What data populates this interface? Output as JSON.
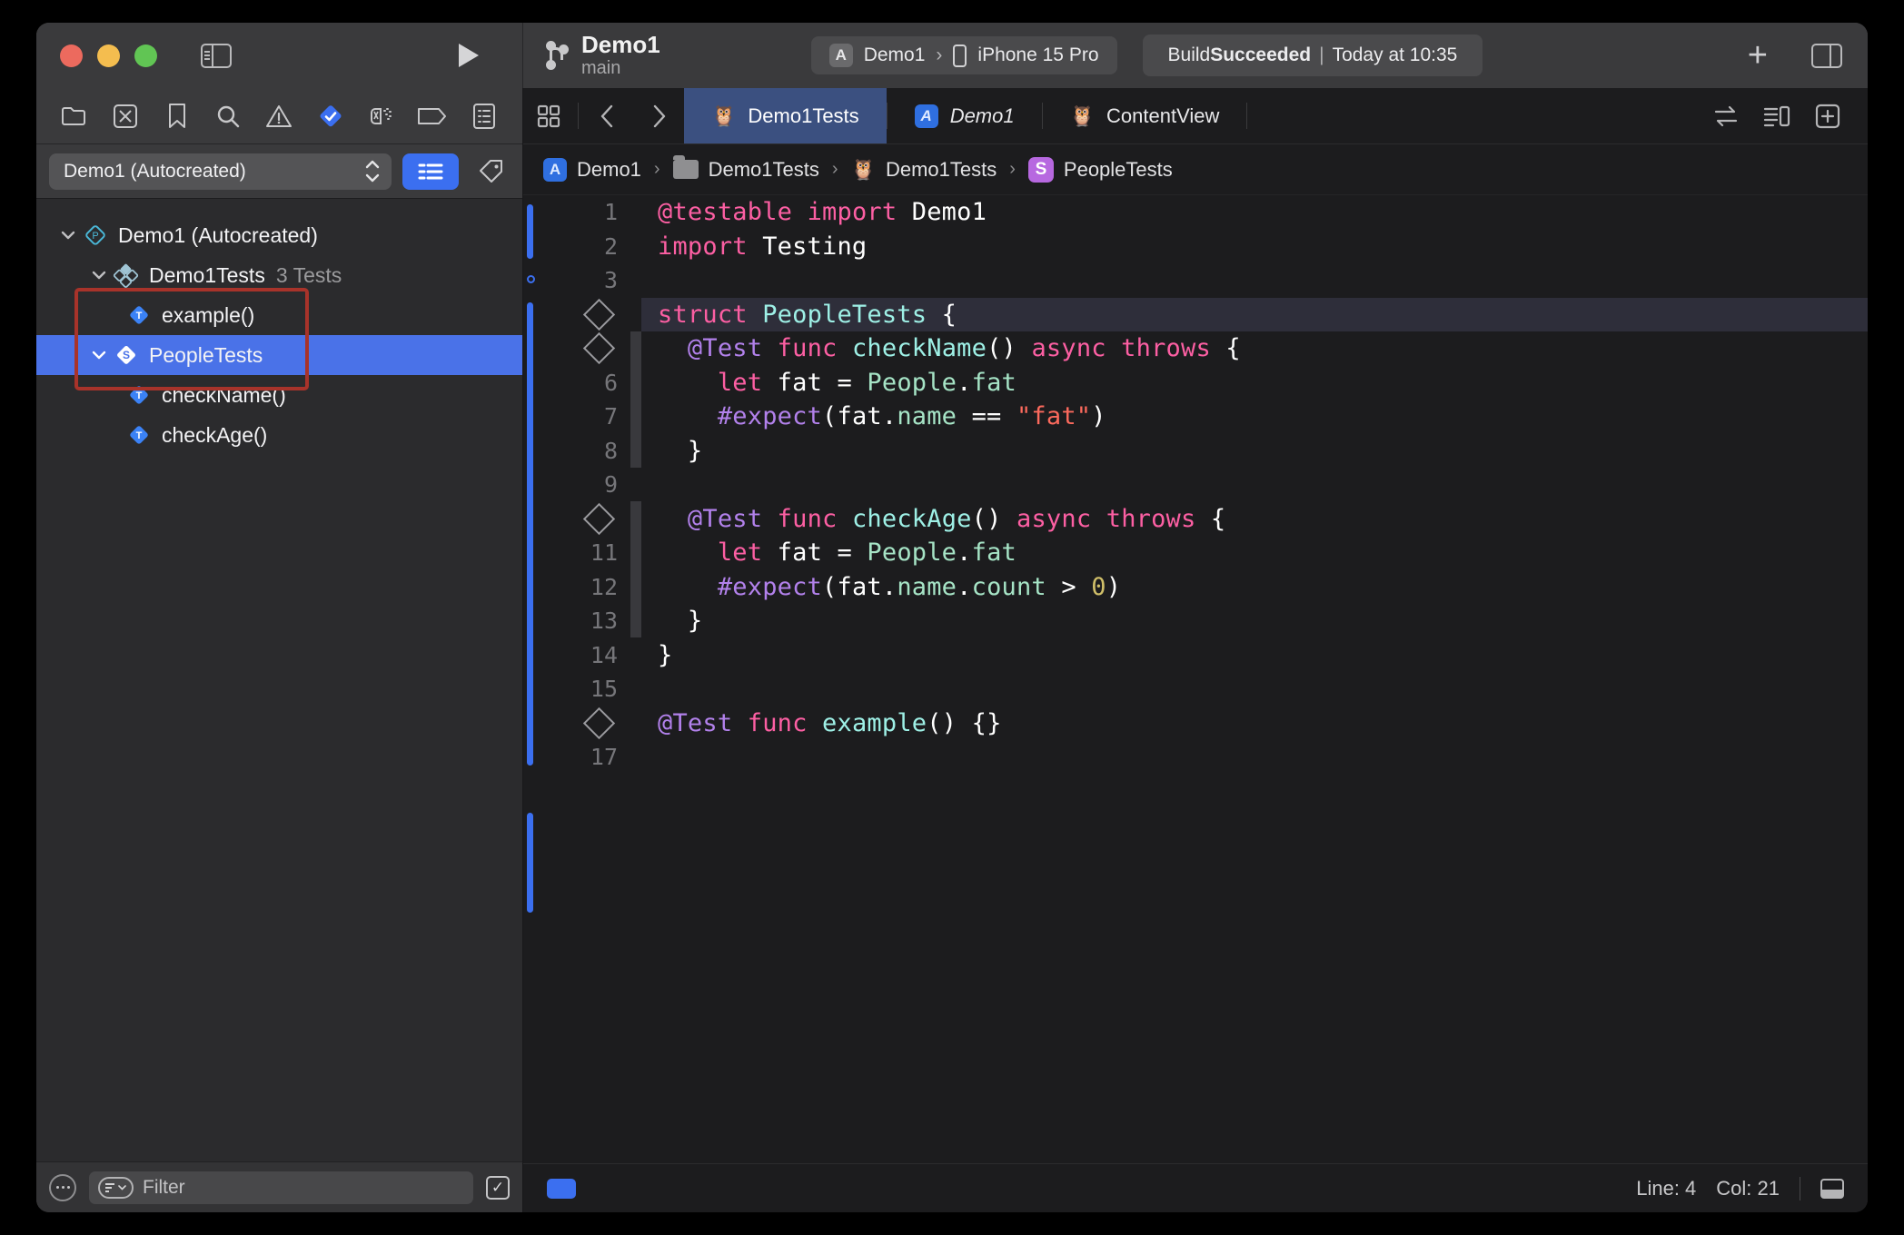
{
  "window": {
    "traffic_lights": [
      "close",
      "minimize",
      "zoom"
    ]
  },
  "titlebar": {
    "project_name": "Demo1",
    "branch": "main",
    "scheme": "Demo1",
    "scheme_separator": "›",
    "destination": "iPhone 15 Pro",
    "status_prefix": "Build ",
    "status_result": "Succeeded",
    "status_separator": "|",
    "status_time": "Today at 10:35",
    "add_label": "+"
  },
  "navigator": {
    "toolbar_icons": [
      "folder-icon",
      "source-control-icon",
      "bookmark-icon",
      "search-icon",
      "issue-warning-icon",
      "test-navigator-icon",
      "debug-navigator-icon",
      "breakpoint-navigator-icon",
      "report-navigator-icon"
    ],
    "scheme_selector": "Demo1 (Autocreated)",
    "list_button": "list-view-icon",
    "tag_button": "tag-icon",
    "tree": [
      {
        "label": "Demo1 (Autocreated)",
        "count": "",
        "icon": "plan-icon",
        "indent": 0,
        "disclosure": "open",
        "selected": false
      },
      {
        "label": "Demo1Tests",
        "count": "3 Tests",
        "icon": "test-bundle-icon",
        "indent": 1,
        "disclosure": "open",
        "selected": false
      },
      {
        "label": "example()",
        "count": "",
        "icon": "test-method-icon",
        "indent": 2,
        "disclosure": "none",
        "selected": false
      },
      {
        "label": "PeopleTests",
        "count": "",
        "icon": "struct-icon",
        "indent": 2,
        "disclosure": "open",
        "selected": true
      },
      {
        "label": "checkName()",
        "count": "",
        "icon": "test-method-icon",
        "indent": 3,
        "disclosure": "none",
        "selected": false
      },
      {
        "label": "checkAge()",
        "count": "",
        "icon": "test-method-icon",
        "indent": 3,
        "disclosure": "none",
        "selected": false
      }
    ],
    "filter_placeholder": "Filter",
    "highlight_color": "#a8332a",
    "selection_color": "#4a72e8"
  },
  "tabbar": {
    "left_icons": [
      "grid-layout-icon",
      "back-chevron-icon",
      "forward-chevron-icon"
    ],
    "tabs": [
      {
        "label": "Demo1Tests",
        "icon": "swift-file-icon",
        "active": true,
        "italic": false
      },
      {
        "label": "Demo1",
        "icon": "xcode-project-icon",
        "active": false,
        "italic": true
      },
      {
        "label": "ContentView",
        "icon": "swift-file-icon",
        "active": false,
        "italic": false
      }
    ],
    "right_icons": [
      "code-review-icon",
      "editor-options-icon",
      "add-editor-icon"
    ]
  },
  "breadcrumb": {
    "arrow": "›",
    "items": [
      {
        "label": "Demo1",
        "icon": "xcode-project-icon"
      },
      {
        "label": "Demo1Tests",
        "icon": "folder-icon"
      },
      {
        "label": "Demo1Tests",
        "icon": "swift-file-icon"
      },
      {
        "label": "PeopleTests",
        "icon": "struct-symbol-icon"
      }
    ]
  },
  "editor": {
    "lines": [
      {
        "n": "1",
        "marker": "number",
        "highlight": false,
        "tokens": [
          {
            "t": "@testable",
            "c": "kw"
          },
          {
            "t": " ",
            "c": "plain"
          },
          {
            "t": "import",
            "c": "kw"
          },
          {
            "t": " Demo1",
            "c": "plain"
          }
        ]
      },
      {
        "n": "2",
        "marker": "number",
        "highlight": false,
        "tokens": [
          {
            "t": "import",
            "c": "kw"
          },
          {
            "t": " Testing",
            "c": "plain"
          }
        ]
      },
      {
        "n": "3",
        "marker": "number",
        "highlight": false,
        "tokens": []
      },
      {
        "n": "4",
        "marker": "diamond",
        "highlight": true,
        "tokens": [
          {
            "t": "struct",
            "c": "kw"
          },
          {
            "t": " ",
            "c": "plain"
          },
          {
            "t": "PeopleTests",
            "c": "typ"
          },
          {
            "t": " {",
            "c": "plain"
          }
        ]
      },
      {
        "n": "5",
        "marker": "diamond",
        "highlight": false,
        "tokens": [
          {
            "t": "  ",
            "c": "plain"
          },
          {
            "t": "@Test",
            "c": "attr"
          },
          {
            "t": " ",
            "c": "plain"
          },
          {
            "t": "func",
            "c": "kw"
          },
          {
            "t": " ",
            "c": "plain"
          },
          {
            "t": "checkName",
            "c": "typ"
          },
          {
            "t": "() ",
            "c": "plain"
          },
          {
            "t": "async throws",
            "c": "kw"
          },
          {
            "t": " {",
            "c": "plain"
          }
        ]
      },
      {
        "n": "6",
        "marker": "number",
        "highlight": false,
        "tokens": [
          {
            "t": "    ",
            "c": "plain"
          },
          {
            "t": "let",
            "c": "kw"
          },
          {
            "t": " fat = ",
            "c": "plain"
          },
          {
            "t": "People",
            "c": "prop"
          },
          {
            "t": ".",
            "c": "plain"
          },
          {
            "t": "fat",
            "c": "prop"
          }
        ]
      },
      {
        "n": "7",
        "marker": "number",
        "highlight": false,
        "tokens": [
          {
            "t": "    ",
            "c": "plain"
          },
          {
            "t": "#expect",
            "c": "attr"
          },
          {
            "t": "(fat.",
            "c": "plain"
          },
          {
            "t": "name",
            "c": "prop"
          },
          {
            "t": " == ",
            "c": "plain"
          },
          {
            "t": "\"fat\"",
            "c": "str"
          },
          {
            "t": ")",
            "c": "plain"
          }
        ]
      },
      {
        "n": "8",
        "marker": "number",
        "highlight": false,
        "tokens": [
          {
            "t": "  }",
            "c": "plain"
          }
        ]
      },
      {
        "n": "9",
        "marker": "number",
        "highlight": false,
        "tokens": []
      },
      {
        "n": "10",
        "marker": "diamond",
        "highlight": false,
        "tokens": [
          {
            "t": "  ",
            "c": "plain"
          },
          {
            "t": "@Test",
            "c": "attr"
          },
          {
            "t": " ",
            "c": "plain"
          },
          {
            "t": "func",
            "c": "kw"
          },
          {
            "t": " ",
            "c": "plain"
          },
          {
            "t": "checkAge",
            "c": "typ"
          },
          {
            "t": "() ",
            "c": "plain"
          },
          {
            "t": "async throws",
            "c": "kw"
          },
          {
            "t": " {",
            "c": "plain"
          }
        ]
      },
      {
        "n": "11",
        "marker": "number",
        "highlight": false,
        "tokens": [
          {
            "t": "    ",
            "c": "plain"
          },
          {
            "t": "let",
            "c": "kw"
          },
          {
            "t": " fat = ",
            "c": "plain"
          },
          {
            "t": "People",
            "c": "prop"
          },
          {
            "t": ".",
            "c": "plain"
          },
          {
            "t": "fat",
            "c": "prop"
          }
        ]
      },
      {
        "n": "12",
        "marker": "number",
        "highlight": false,
        "tokens": [
          {
            "t": "    ",
            "c": "plain"
          },
          {
            "t": "#expect",
            "c": "attr"
          },
          {
            "t": "(fat.",
            "c": "plain"
          },
          {
            "t": "name",
            "c": "prop"
          },
          {
            "t": ".",
            "c": "plain"
          },
          {
            "t": "count",
            "c": "prop"
          },
          {
            "t": " > ",
            "c": "plain"
          },
          {
            "t": "0",
            "c": "num"
          },
          {
            "t": ")",
            "c": "plain"
          }
        ]
      },
      {
        "n": "13",
        "marker": "number",
        "highlight": false,
        "tokens": [
          {
            "t": "  }",
            "c": "plain"
          }
        ]
      },
      {
        "n": "14",
        "marker": "number",
        "highlight": false,
        "tokens": [
          {
            "t": "}",
            "c": "plain"
          }
        ]
      },
      {
        "n": "15",
        "marker": "number",
        "highlight": false,
        "tokens": []
      },
      {
        "n": "16",
        "marker": "diamond",
        "highlight": false,
        "tokens": [
          {
            "t": "@Test",
            "c": "attr"
          },
          {
            "t": " ",
            "c": "plain"
          },
          {
            "t": "func",
            "c": "kw"
          },
          {
            "t": " ",
            "c": "plain"
          },
          {
            "t": "example",
            "c": "typ"
          },
          {
            "t": "() {}",
            "c": "plain"
          }
        ]
      },
      {
        "n": "17",
        "marker": "number",
        "highlight": false,
        "tokens": []
      }
    ]
  },
  "statusbar": {
    "line_label": "Line: 4",
    "col_label": "Col: 21",
    "minimap_icon": "minimap-icon"
  }
}
